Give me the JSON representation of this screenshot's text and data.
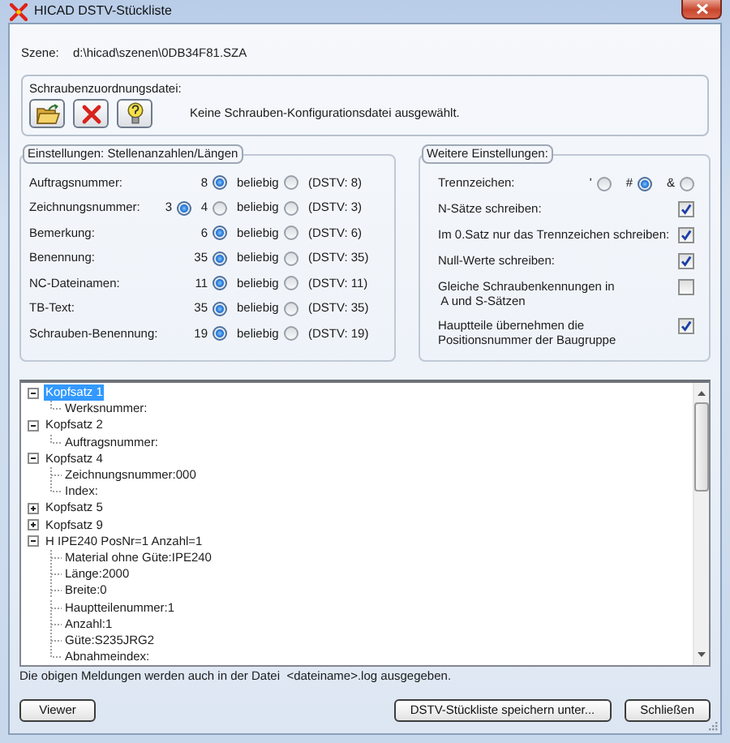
{
  "window": {
    "title": "HICAD DSTV-Stückliste"
  },
  "scene": {
    "label": "Szene:",
    "value": "d:\\hicad\\szenen\\0DB34F81.SZA"
  },
  "bolt_file": {
    "title": "Schraubenzuordnungsdatei:",
    "status": "Keine Schrauben-Konfigurationsdatei ausgewählt."
  },
  "digit_settings": {
    "title": "Einstellungen: Stellenanzahlen/Längen",
    "rows": [
      {
        "label": "Auftragsnummer:",
        "options": [
          {
            "label": "8",
            "selected": true
          },
          {
            "label": "beliebig",
            "selected": false
          }
        ],
        "dstv": "(DSTV: 8)"
      },
      {
        "label": "Zeichnungsnummer:",
        "options": [
          {
            "label": "3",
            "selected": true
          },
          {
            "label": "4",
            "selected": false
          },
          {
            "label": "beliebig",
            "selected": false
          }
        ],
        "dstv": "(DSTV: 3)"
      },
      {
        "label": "Bemerkung:",
        "options": [
          {
            "label": "6",
            "selected": true
          },
          {
            "label": "beliebig",
            "selected": false
          }
        ],
        "dstv": "(DSTV: 6)"
      },
      {
        "label": "Benennung:",
        "options": [
          {
            "label": "35",
            "selected": true
          },
          {
            "label": "beliebig",
            "selected": false
          }
        ],
        "dstv": "(DSTV: 35)"
      },
      {
        "label": "NC-Dateinamen:",
        "options": [
          {
            "label": "11",
            "selected": true
          },
          {
            "label": "beliebig",
            "selected": false
          }
        ],
        "dstv": "(DSTV: 11)"
      },
      {
        "label": "TB-Text:",
        "options": [
          {
            "label": "35",
            "selected": true
          },
          {
            "label": "beliebig",
            "selected": false
          }
        ],
        "dstv": "(DSTV: 35)"
      },
      {
        "label": "Schrauben-Benennung:",
        "options": [
          {
            "label": "19",
            "selected": true
          },
          {
            "label": "beliebig",
            "selected": false
          }
        ],
        "dstv": "(DSTV: 19)"
      }
    ]
  },
  "further_settings": {
    "title": "Weitere Einstellungen:",
    "separator": {
      "label": "Trennzeichen:",
      "options": [
        {
          "label": "'",
          "selected": false
        },
        {
          "label": "#",
          "selected": true
        },
        {
          "label": "&",
          "selected": false
        }
      ]
    },
    "checks": [
      {
        "label": "N-Sätze schreiben:",
        "checked": true
      },
      {
        "label": "Im 0.Satz nur das Trennzeichen schreiben:",
        "checked": true
      },
      {
        "label": "Null-Werte schreiben:",
        "checked": true
      },
      {
        "label": "Gleiche Schraubenkennungen in\n A und S-Sätzen",
        "checked": false
      },
      {
        "label": "Hauptteile übernehmen die\nPositionsnummer der Baugruppe",
        "checked": true
      }
    ]
  },
  "tree": {
    "items": [
      {
        "label": "Kopfsatz 1",
        "selected": true,
        "expanded": true,
        "children": [
          {
            "label": "Werksnummer:",
            "selected": false
          }
        ]
      },
      {
        "label": "Kopfsatz 2",
        "selected": false,
        "expanded": true,
        "children": [
          {
            "label": "Auftragsnummer:",
            "selected": false
          }
        ]
      },
      {
        "label": "Kopfsatz 4",
        "selected": false,
        "expanded": true,
        "children": [
          {
            "label": "Zeichnungsnummer:000",
            "selected": false
          },
          {
            "label": "Index:",
            "selected": false
          }
        ]
      },
      {
        "label": "Kopfsatz 5",
        "selected": false,
        "expanded": false
      },
      {
        "label": "Kopfsatz 9",
        "selected": false,
        "expanded": false
      },
      {
        "label": "H IPE240 PosNr=1 Anzahl=1",
        "selected": false,
        "expanded": true,
        "children": [
          {
            "label": "Material ohne Güte:IPE240",
            "selected": false
          },
          {
            "label": "Länge:2000",
            "selected": false
          },
          {
            "label": "Breite:0",
            "selected": false
          },
          {
            "label": "Hauptteilenummer:1",
            "selected": false
          },
          {
            "label": "Anzahl:1",
            "selected": false
          },
          {
            "label": "Güte:S235JRG2",
            "selected": false
          },
          {
            "label": "Abnahmeindex:",
            "selected": false
          }
        ]
      }
    ]
  },
  "log_note": "Die obigen Meldungen werden auch in der Datei  <dateiname>.log ausgegeben.",
  "buttons": {
    "left": [
      "Viewer"
    ],
    "right": [
      "DSTV-Stückliste speichern unter...",
      "Schließen"
    ]
  }
}
